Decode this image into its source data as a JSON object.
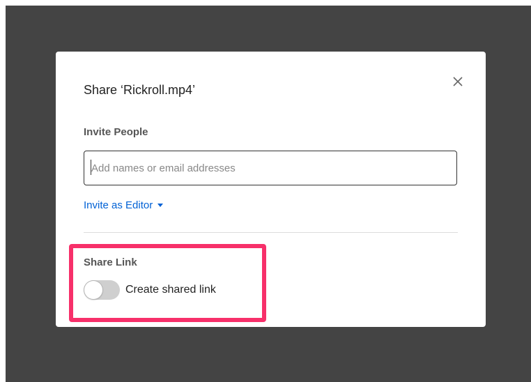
{
  "dialog": {
    "title": "Share ‘Rickroll.mp4’",
    "close_icon": "close-icon",
    "invite_section": {
      "label": "Invite People",
      "input_placeholder": "Add names or email addresses",
      "input_value": "",
      "role_dropdown_label": "Invite as Editor",
      "role_dropdown_icon": "caret-down-icon"
    },
    "share_link_section": {
      "label": "Share Link",
      "toggle_label": "Create shared link",
      "toggle_on": false
    }
  },
  "colors": {
    "backdrop": "#444444",
    "link": "#0061d5",
    "highlight": "#f7306a"
  }
}
